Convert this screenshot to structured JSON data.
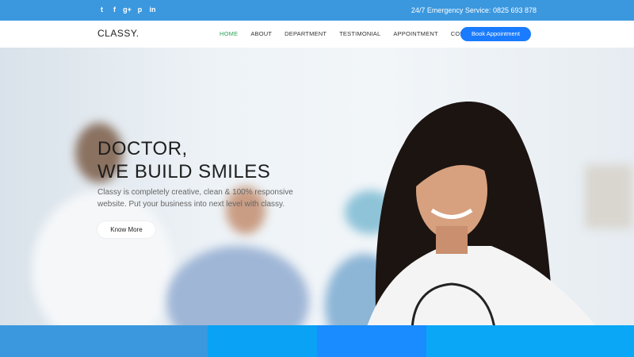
{
  "topbar": {
    "social_icons": [
      "twitter-icon",
      "facebook-icon",
      "google-plus-icon",
      "pinterest-icon",
      "linkedin-icon"
    ],
    "social_glyphs": [
      "t",
      "f",
      "g+",
      "p",
      "in"
    ],
    "emergency": "24/7 Emergency Service: 0825 693 878"
  },
  "nav": {
    "logo": "CLASSY.",
    "items": [
      "HOME",
      "ABOUT",
      "DEPARTMENT",
      "TESTIMONIAL",
      "APPOINTMENT",
      "CONTACT"
    ],
    "active": "HOME",
    "book_label": "Book Appointment"
  },
  "hero": {
    "title_line1": "DOCTOR,",
    "title_line2": "WE BUILD SMILES",
    "subtitle": "Classy is completely creative, clean & 100% responsive website. Put your business into next level with classy.",
    "button": "Know More"
  },
  "colors": {
    "topbar": "#3b98df",
    "active_nav": "#2aa55a",
    "book_button": "#1a7bff",
    "strip": [
      "#3b98df",
      "#0aa2f5",
      "#1a8cff",
      "#09a7f6"
    ]
  }
}
